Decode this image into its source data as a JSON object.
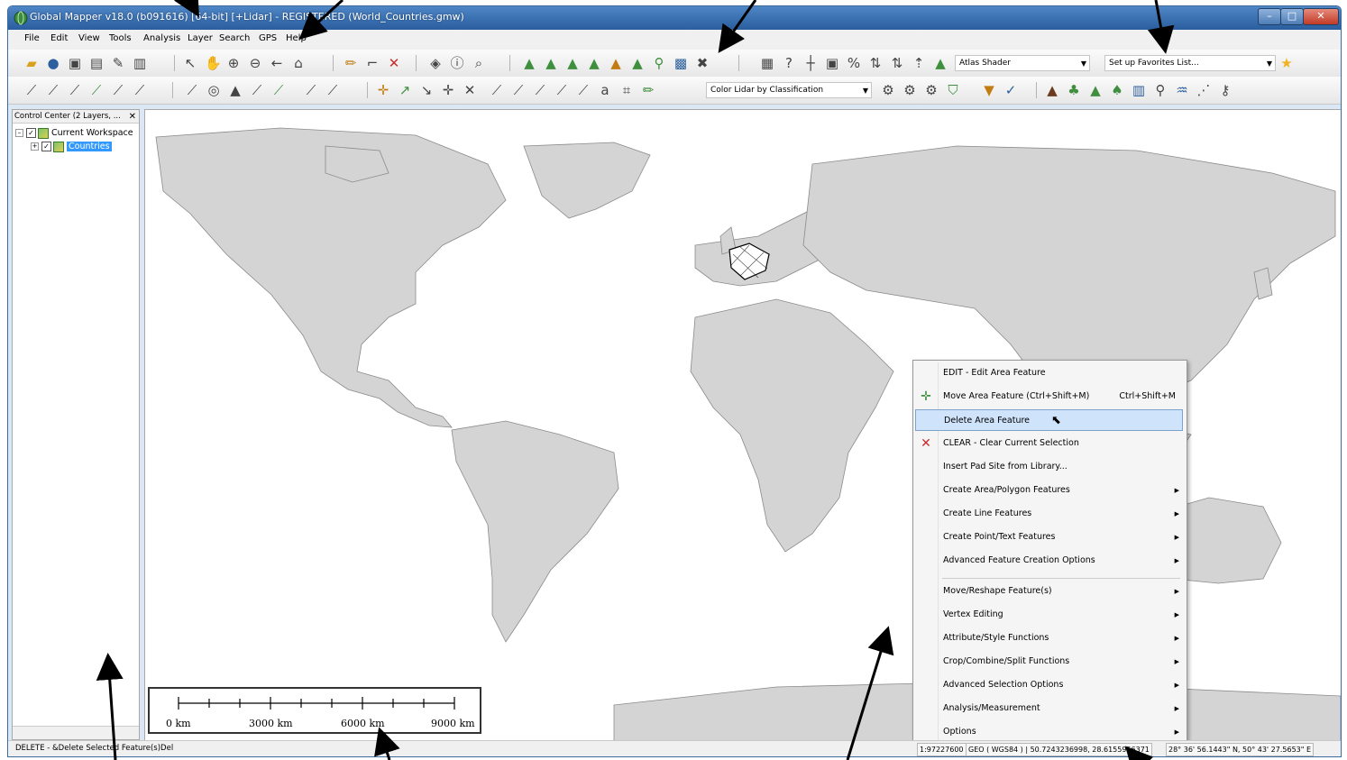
{
  "window": {
    "title": "Global Mapper v18.0 (b091616) [64-bit] [+Lidar] - REGISTERED (World_Countries.gmw)"
  },
  "menu": [
    "File",
    "Edit",
    "View",
    "Tools",
    "Analysis",
    "Layer",
    "Search",
    "GPS",
    "Help"
  ],
  "toolbar": {
    "shader_combo": "Atlas Shader",
    "favorites_combo": "Set up Favorites List...",
    "lidar_color_combo": "Color Lidar by Classification"
  },
  "control_center": {
    "header": "Control Center (2 Layers, ...",
    "workspace_label": "Current Workspace",
    "layer_label": "Countries"
  },
  "context_menu": {
    "items": [
      {
        "label": "EDIT - Edit Area Feature",
        "shortcut": "",
        "submenu": false
      },
      {
        "label": "Move Area Feature (Ctrl+Shift+M)",
        "shortcut": "Ctrl+Shift+M",
        "submenu": false
      },
      {
        "label": "Delete Area Feature",
        "shortcut": "",
        "submenu": false
      },
      {
        "label": "CLEAR - Clear Current Selection",
        "shortcut": "",
        "submenu": false
      },
      {
        "label": "Insert Pad Site from Library...",
        "shortcut": "",
        "submenu": false
      },
      {
        "label": "Create Area/Polygon Features",
        "shortcut": "",
        "submenu": true
      },
      {
        "label": "Create Line Features",
        "shortcut": "",
        "submenu": true
      },
      {
        "label": "Create Point/Text Features",
        "shortcut": "",
        "submenu": true
      },
      {
        "label": "Advanced Feature Creation Options",
        "shortcut": "",
        "submenu": true
      },
      {
        "label": "Move/Reshape Feature(s)",
        "shortcut": "",
        "submenu": true
      },
      {
        "label": "Vertex Editing",
        "shortcut": "",
        "submenu": true
      },
      {
        "label": "Attribute/Style Functions",
        "shortcut": "",
        "submenu": true
      },
      {
        "label": "Crop/Combine/Split Functions",
        "shortcut": "",
        "submenu": true
      },
      {
        "label": "Advanced Selection Options",
        "shortcut": "",
        "submenu": true
      },
      {
        "label": "Analysis/Measurement",
        "shortcut": "",
        "submenu": true
      },
      {
        "label": "Options",
        "shortcut": "",
        "submenu": true
      }
    ],
    "submenu_glyph": "▶"
  },
  "scale_bar": {
    "labels": [
      "0 km",
      "3000 km",
      "6000 km",
      "9000 km"
    ]
  },
  "status": {
    "left": "DELETE - &Delete Selected Feature(s)Del",
    "scale": "1:97227600",
    "projection": "GEO ( WGS84 ) | 50.7243236998, 28.6155956371",
    "dms": "28° 36' 56.1443\" N, 50° 43' 27.5653\" E"
  },
  "colors": {
    "land": "#d4d4d4",
    "border": "#8a8a8a",
    "highlight": "#cfe3fb",
    "title_bar": "#3a6fb0"
  },
  "icons": [
    "app-globe-icon",
    "open-folder-icon",
    "globe-icon",
    "save-icon",
    "zoom-in-icon",
    "zoom-out-icon",
    "pan-hand-icon",
    "back-arrow-icon",
    "home-icon",
    "digitizer-pencil-icon",
    "delete-x-icon",
    "info-icon",
    "terrain-icon",
    "favorites-star-icon",
    "move-cross-icon",
    "clear-x-icon",
    "checkbox-icon",
    "layer-icon",
    "cursor-icon"
  ]
}
